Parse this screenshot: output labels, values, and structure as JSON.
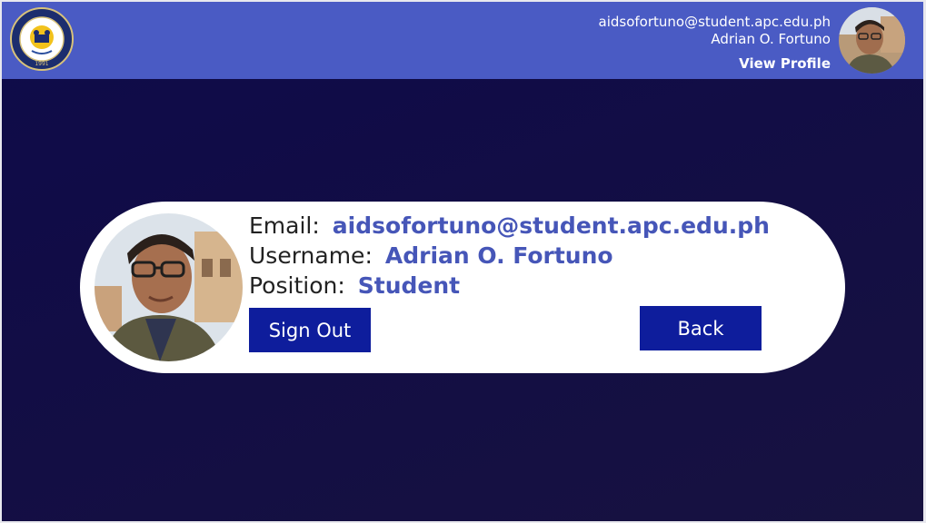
{
  "header": {
    "logo_icon": "apc-seal-logo",
    "logo_text": "ASIA PACIFIC COLLEGE",
    "logo_year": "1991",
    "user_email": "aidsofortuno@student.apc.edu.ph",
    "user_name": "Adrian O. Fortuno",
    "view_profile_label": "View Profile",
    "background_color": "#4a5bc4"
  },
  "profile_card": {
    "email_label": "Email:",
    "email_value": "aidsofortuno@student.apc.edu.ph",
    "username_label": "Username:",
    "username_value": "Adrian O. Fortuno",
    "position_label": "Position:",
    "position_value": "Student",
    "sign_out_label": "Sign Out",
    "back_label": "Back",
    "value_color": "#4656b8",
    "button_color": "#0e1d9c"
  },
  "background_color": "#120d45"
}
